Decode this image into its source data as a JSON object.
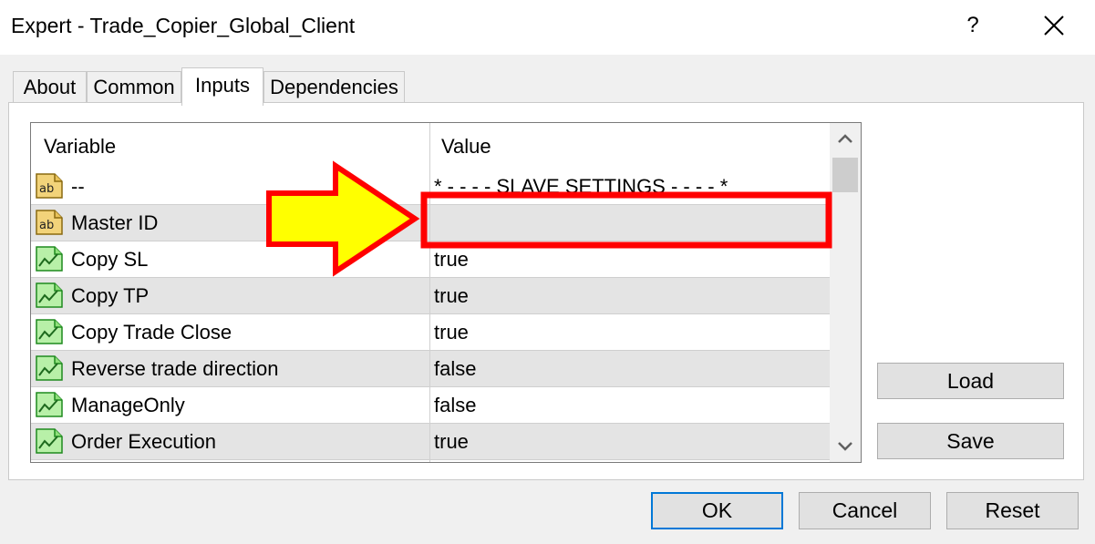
{
  "window": {
    "title": "Expert - Trade_Copier_Global_Client",
    "help_label": "?"
  },
  "tabs": [
    {
      "label": "About"
    },
    {
      "label": "Common"
    },
    {
      "label": "Inputs"
    },
    {
      "label": "Dependencies"
    }
  ],
  "active_tab": "Inputs",
  "grid": {
    "headers": {
      "variable": "Variable",
      "value": "Value"
    },
    "rows": [
      {
        "icon": "string-type-icon",
        "variable": "--",
        "value": "* - - - - SLAVE SETTINGS - - - - *"
      },
      {
        "icon": "string-type-icon",
        "variable": "Master ID",
        "value": ""
      },
      {
        "icon": "boolean-type-icon",
        "variable": "Copy SL",
        "value": "true"
      },
      {
        "icon": "boolean-type-icon",
        "variable": "Copy TP",
        "value": "true"
      },
      {
        "icon": "boolean-type-icon",
        "variable": "Copy Trade Close",
        "value": "true"
      },
      {
        "icon": "boolean-type-icon",
        "variable": "Reverse trade direction",
        "value": "false"
      },
      {
        "icon": "boolean-type-icon",
        "variable": "ManageOnly",
        "value": "false"
      },
      {
        "icon": "boolean-type-icon",
        "variable": "Order Execution",
        "value": "true"
      }
    ]
  },
  "side_buttons": {
    "load": "Load",
    "save": "Save"
  },
  "footer_buttons": {
    "ok": "OK",
    "cancel": "Cancel",
    "reset": "Reset"
  },
  "annotation": {
    "arrow_color": "#ffff00",
    "highlight_color": "#ff0000"
  }
}
